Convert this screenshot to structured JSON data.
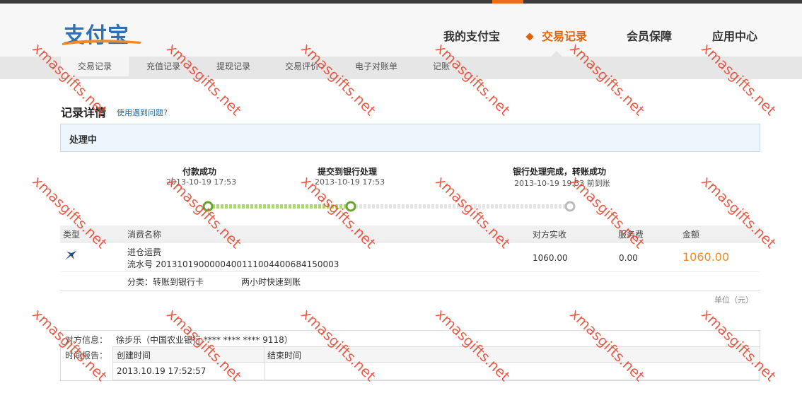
{
  "colors": {
    "accent": "#e36209",
    "link": "#1a6fb0",
    "amount": "#f08a24",
    "progress_done": "#8fc83a",
    "progress_pending": "#cccccc"
  },
  "logo": {
    "text": "支付宝"
  },
  "main_nav": [
    {
      "label": "我的支付宝",
      "active": false
    },
    {
      "label": "交易记录",
      "active": true
    },
    {
      "label": "会员保障",
      "active": false
    },
    {
      "label": "应用中心",
      "active": false
    }
  ],
  "sub_nav": [
    {
      "label": "交易记录",
      "active": true
    },
    {
      "label": "充值记录"
    },
    {
      "label": "提现记录"
    },
    {
      "label": "交易评价"
    },
    {
      "label": "电子对账单"
    },
    {
      "label": "记账"
    }
  ],
  "page": {
    "title": "记录详情",
    "help_link": "使用遇到问题?"
  },
  "status": {
    "text": "处理中"
  },
  "steps": [
    {
      "title": "付款成功",
      "time": "2013-10-19 17:53",
      "state": "done"
    },
    {
      "title": "提交到银行处理",
      "time": "2013-10-19 17:53",
      "state": "current"
    },
    {
      "title": "银行处理完成，转账成功",
      "time": "2013-10-19 19:53 前到账",
      "state": "pending"
    }
  ],
  "table": {
    "headers": {
      "type": "类型",
      "name": "消费名称",
      "received": "对方实收",
      "fee": "服务费",
      "amount": "金额"
    },
    "row": {
      "icon": "transfer-swallow-icon",
      "name": "进仓运费",
      "serial": "流水号 2013101900000400111004400684150003",
      "received": "1060.00",
      "fee": "0.00",
      "amount": "1060.00"
    },
    "category": "分类：转账到银行卡",
    "speed": "两小时快速到账"
  },
  "unit": "单位（元）",
  "counterparty": {
    "label": "对方信息：",
    "value": "徐步乐（中国农业银行 **** **** **** 9118）"
  },
  "time_report": {
    "label": "时间报告：",
    "created_label": "创建时间",
    "ended_label": "结束时间",
    "created_value": "2013.10.19 17:52:57",
    "ended_value": ""
  },
  "watermark": "xmasgifts.net"
}
